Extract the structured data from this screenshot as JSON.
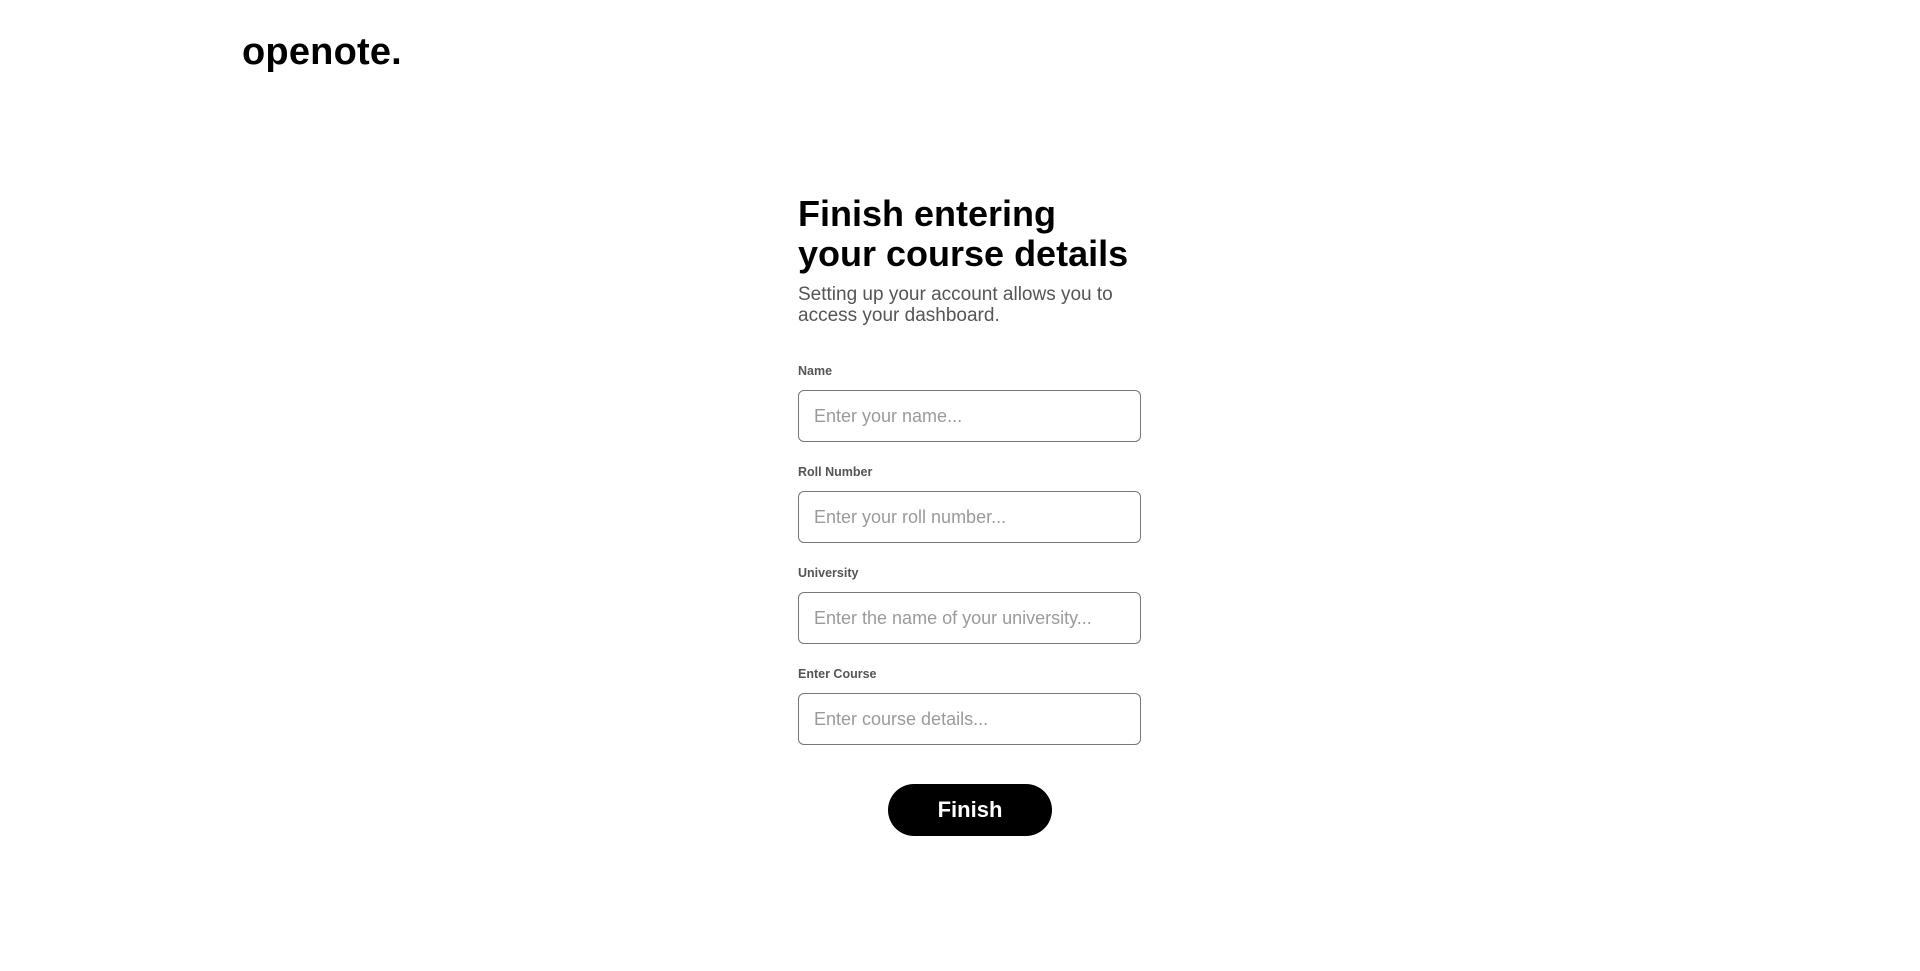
{
  "brand": {
    "logo_text": "openote."
  },
  "form": {
    "title": "Finish entering your course details",
    "subtitle": "Setting up your account allows you to access your dashboard.",
    "fields": [
      {
        "label": "Name",
        "placeholder": "Enter your name...",
        "value": ""
      },
      {
        "label": "Roll Number",
        "placeholder": "Enter your roll number...",
        "value": ""
      },
      {
        "label": "University",
        "placeholder": "Enter the name of your university...",
        "value": ""
      },
      {
        "label": "Enter Course",
        "placeholder": "Enter course details...",
        "value": ""
      }
    ],
    "submit_label": "Finish"
  },
  "colors": {
    "background": "#ffffff",
    "text_primary": "#000000",
    "text_secondary": "#555555",
    "placeholder": "#9a9a9a",
    "input_border": "#777777",
    "button_bg": "#000000",
    "button_text": "#ffffff"
  }
}
